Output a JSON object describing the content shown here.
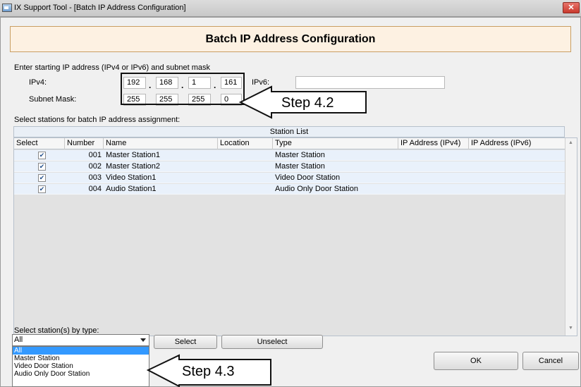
{
  "window": {
    "title": "IX Support Tool - [Batch IP Address Configuration]",
    "close_label": "✕"
  },
  "header": {
    "title": "Batch IP Address Configuration"
  },
  "ip_section": {
    "instruction": "Enter starting IP address (IPv4 or IPv6) and subnet mask",
    "ipv4_label": "IPv4:",
    "ipv4_octets": [
      "192",
      "168",
      "1",
      "161"
    ],
    "ipv6_label": "IPv6:",
    "ipv6_value": "",
    "subnet_label": "Subnet Mask:",
    "subnet_octets": [
      "255",
      "255",
      "255",
      "0"
    ],
    "octet_separator": "."
  },
  "station_section": {
    "instruction": "Select stations for batch IP address assignment:",
    "table_title": "Station List",
    "columns": [
      "Select",
      "Number",
      "Name",
      "Location",
      "Type",
      "IP Address (IPv4)",
      "IP Address (IPv6)"
    ],
    "rows": [
      {
        "checked": "✔",
        "number": "001",
        "name": "Master Station1",
        "location": "",
        "type": "Master Station",
        "ipv4": "",
        "ipv6": ""
      },
      {
        "checked": "✔",
        "number": "002",
        "name": "Master Station2",
        "location": "",
        "type": "Master Station",
        "ipv4": "",
        "ipv6": ""
      },
      {
        "checked": "✔",
        "number": "003",
        "name": "Video Station1",
        "location": "",
        "type": "Video Door Station",
        "ipv4": "",
        "ipv6": ""
      },
      {
        "checked": "✔",
        "number": "004",
        "name": "Audio Station1",
        "location": "",
        "type": "Audio Only Door Station",
        "ipv4": "",
        "ipv6": ""
      }
    ],
    "scroll_up": "▲",
    "scroll_down": "▼"
  },
  "type_section": {
    "label": "Select station(s) by type:",
    "selected": "All",
    "options": [
      "All",
      "Master Station",
      "Video Door Station",
      "Audio Only Door Station"
    ],
    "select_button": "Select",
    "unselect_button": "Unselect"
  },
  "footer": {
    "ok_button": "OK",
    "cancel_button": "Cancel"
  },
  "callouts": {
    "step_42": "Step 4.2",
    "step_43": "Step 4.3"
  }
}
